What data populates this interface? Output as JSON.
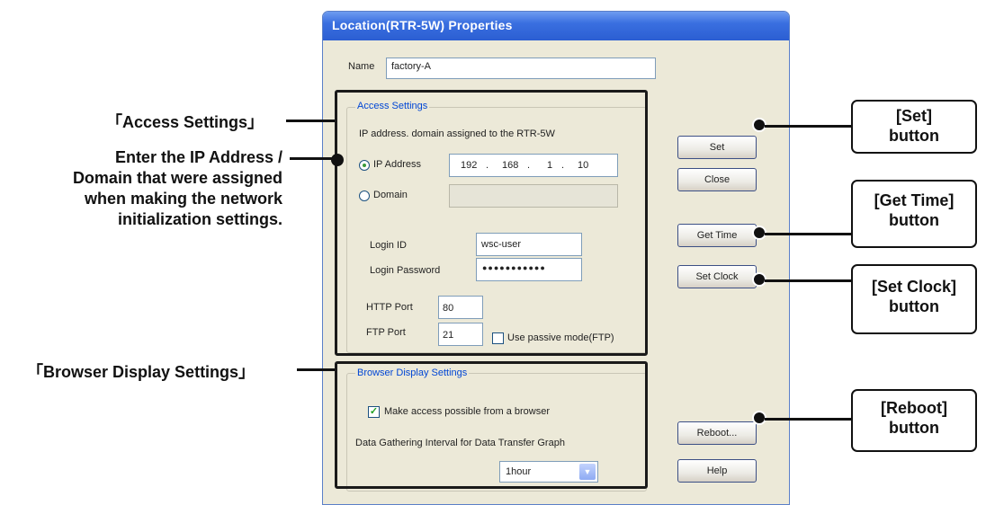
{
  "window": {
    "title": "Location(RTR-5W) Properties"
  },
  "name": {
    "label": "Name",
    "value": "factory-A"
  },
  "access": {
    "group_title": "Access Settings",
    "description": "IP address. domain assigned to the RTR-5W",
    "ip_label": "IP Address",
    "ip_octets": [
      "192",
      "168",
      "1",
      "10"
    ],
    "ip_separator": ".",
    "domain_label": "Domain",
    "domain_value": "",
    "login_id_label": "Login ID",
    "login_id_value": "wsc-user",
    "password_label": "Login Password",
    "password_value": "●●●●●●●●●●●",
    "http_port_label": "HTTP Port",
    "http_port_value": "80",
    "ftp_port_label": "FTP Port",
    "ftp_port_value": "21",
    "passive_label": "Use passive mode(FTP)"
  },
  "browser": {
    "group_title": "Browser Display Settings",
    "make_access_label": "Make access possible from a browser",
    "interval_label": "Data Gathering Interval for Data Transfer Graph",
    "interval_value": "1hour"
  },
  "buttons": {
    "set": "Set",
    "close": "Close",
    "get_time": "Get Time",
    "set_clock": "Set Clock",
    "reboot": "Reboot...",
    "help": "Help"
  },
  "annotations": {
    "access_settings": "「Access Settings」",
    "enter_ip_line1": "Enter the IP Address /",
    "enter_ip_line2": "Domain that were assigned",
    "enter_ip_line3": "when making the network",
    "enter_ip_line4": "initialization settings.",
    "browser_settings": "「Browser Display Settings」",
    "set_btn_line1": "[Set]",
    "set_btn_line2": "button",
    "get_time_line1": "[Get Time]",
    "get_time_line2": "button",
    "set_clock_line1": "[Set Clock]",
    "set_clock_line2": "button",
    "reboot_line1": "[Reboot]",
    "reboot_line2": "button"
  },
  "colors": {
    "titlebar": "#2b5ed2",
    "group_title": "#0046d5",
    "dialog_bg": "#ece9d8"
  }
}
